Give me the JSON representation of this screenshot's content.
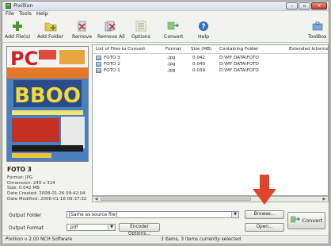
{
  "window": {
    "title": "Pixillion"
  },
  "menu": [
    "File",
    "Tools",
    "Help"
  ],
  "toolbar": {
    "add_files": "Add File(s)",
    "add_folder": "Add Folder",
    "remove": "Remove",
    "remove_all": "Remove All",
    "options": "Options",
    "convert": "Convert",
    "help": "Help",
    "toolbox": "ToolBox"
  },
  "preview": {
    "filename": "FOTO 3",
    "format": "Format: JPG",
    "dimension": "Dimension: 240 x 314",
    "size": "Size: 0.042 MB",
    "created": "Date Created: 2008-01-26 09:42:04",
    "modified": "Date Modified: 2008-01-18 09:37:32",
    "cover_title": "PC",
    "cover_badge": "ВВОО"
  },
  "list": {
    "headers": {
      "name": "List of Files to Convert",
      "format": "Format",
      "size": "Size (MB)",
      "folder": "Containing Folder",
      "ext": "Extended Information"
    },
    "rows": [
      {
        "name": "FOTO 3",
        "format": ".jpg",
        "size": "0.042",
        "folder": "D:\\MY DATA\\FOTO"
      },
      {
        "name": "FOTO 2",
        "format": ".jpg",
        "size": "0.040",
        "folder": "D:\\MY DATA\\FOTO"
      },
      {
        "name": "FOTO 1",
        "format": ".jpg",
        "size": "0.039",
        "folder": "D:\\MY DATA\\FOTO"
      }
    ]
  },
  "output": {
    "folder_label": "Output Folder",
    "folder_value": "[Same as source file]",
    "format_label": "Output Format",
    "format_value": ".pdf",
    "encoder_button": "Encoder Options...",
    "browse_button": "Browse...",
    "open_button": "Open...",
    "convert_button": "Convert"
  },
  "status": {
    "left": "Pixillion v 2.00  NCH Software",
    "center": "3 items, 3 items currently selected"
  },
  "colors": {
    "annotation_arrow": "#e0452c",
    "accent_green": "#3f9a2c"
  }
}
